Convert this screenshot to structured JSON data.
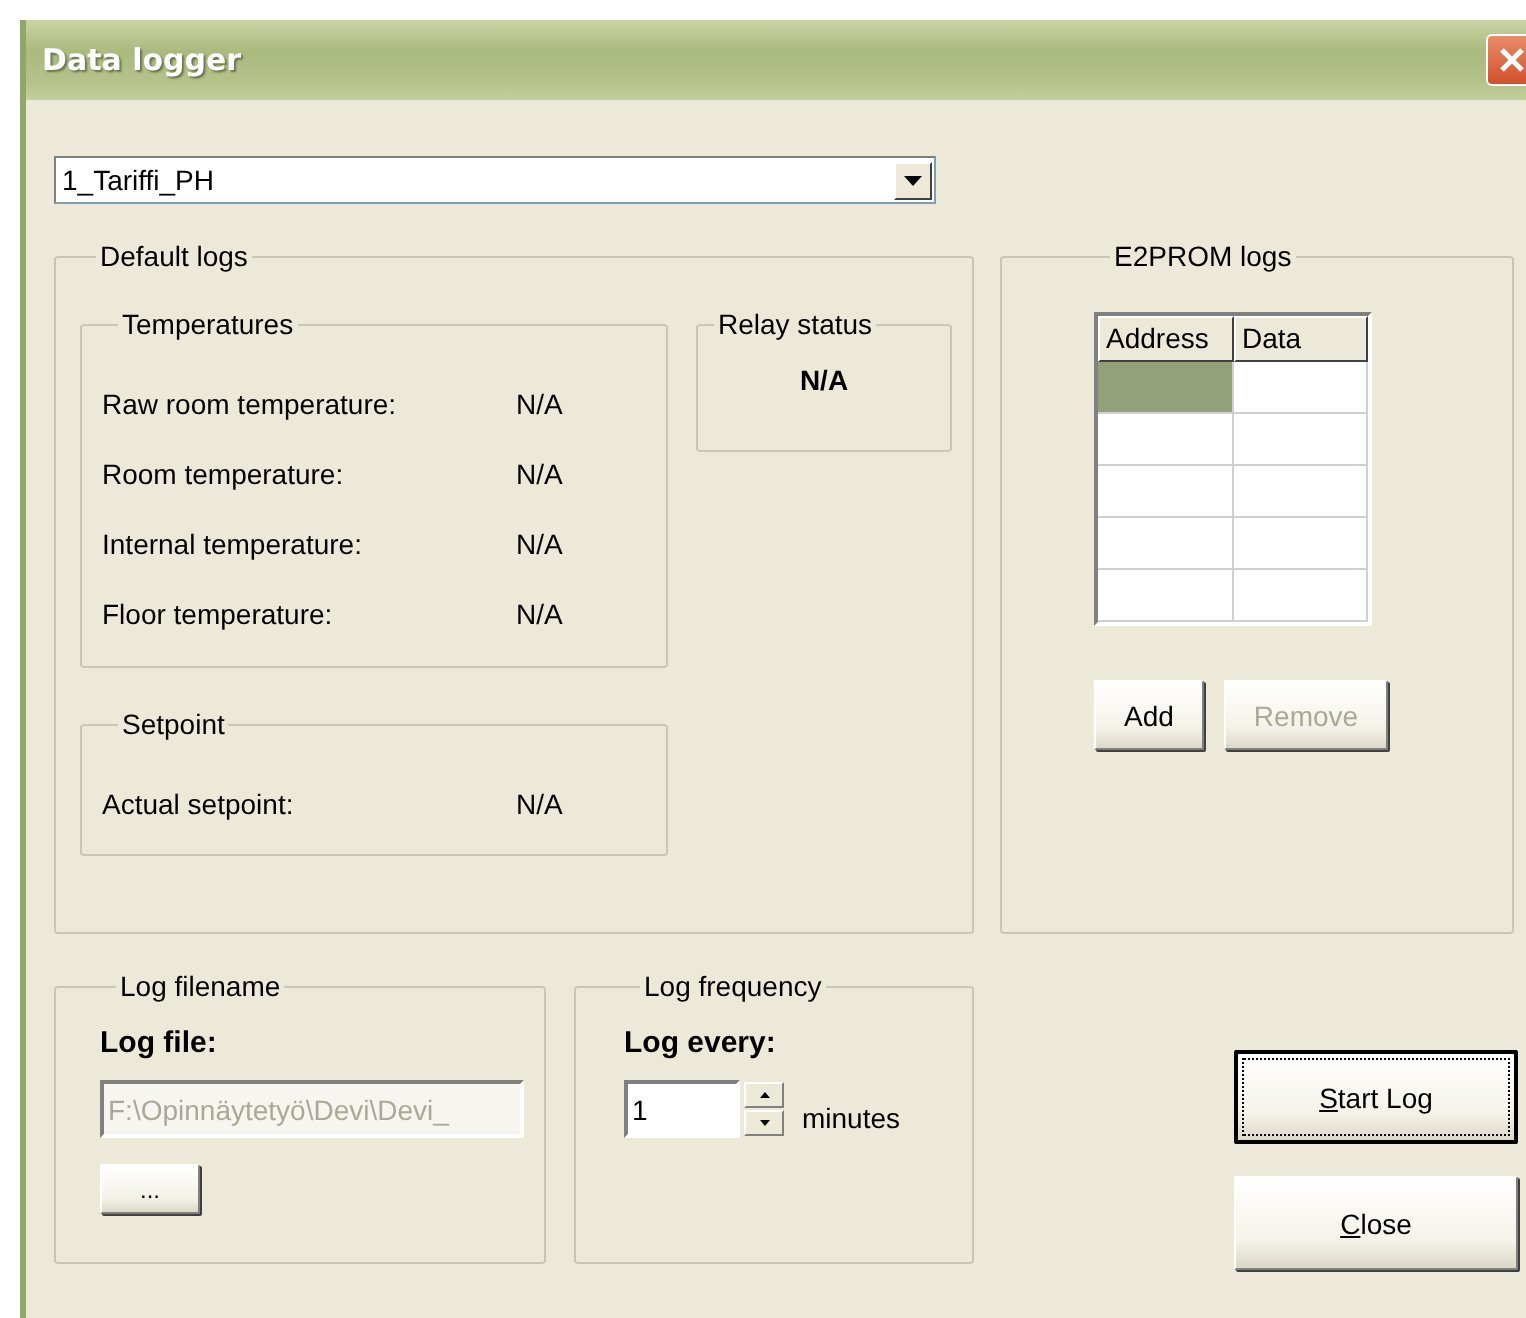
{
  "window": {
    "title": "Data logger"
  },
  "profile_select": {
    "value": "1_Tariffi_PH"
  },
  "default_logs": {
    "title": "Default logs",
    "temperatures": {
      "title": "Temperatures",
      "rows": [
        {
          "label": "Raw room temperature:",
          "value": "N/A"
        },
        {
          "label": "Room temperature:",
          "value": "N/A"
        },
        {
          "label": "Internal temperature:",
          "value": "N/A"
        },
        {
          "label": "Floor temperature:",
          "value": "N/A"
        }
      ]
    },
    "relay_status": {
      "title": "Relay status",
      "value": "N/A"
    },
    "setpoint": {
      "title": "Setpoint",
      "rows": [
        {
          "label": "Actual setpoint:",
          "value": "N/A"
        }
      ]
    }
  },
  "e2prom_logs": {
    "title": "E2PROM logs",
    "table": {
      "columns": [
        "Address",
        "Data"
      ],
      "rows": [
        {
          "cells": [
            {
              "selected": true
            },
            {
              "selected": false
            }
          ]
        },
        {
          "cells": [
            {
              "selected": false
            },
            {
              "selected": false
            }
          ]
        },
        {
          "cells": [
            {
              "selected": false
            },
            {
              "selected": false
            }
          ]
        },
        {
          "cells": [
            {
              "selected": false
            },
            {
              "selected": false
            }
          ]
        },
        {
          "cells": [
            {
              "selected": false
            },
            {
              "selected": false
            }
          ]
        }
      ]
    },
    "buttons": [
      {
        "label": "Add",
        "disabled": false
      },
      {
        "label": "Remove",
        "disabled": true
      }
    ]
  },
  "log_filename": {
    "title": "Log filename",
    "label": "Log file:",
    "value": "F:\\Opinnäytetyö\\Devi\\Devi_",
    "disabled": true,
    "browse_button": "..."
  },
  "log_frequency": {
    "title": "Log frequency",
    "label": "Log every:",
    "value": "1",
    "unit": "minutes"
  },
  "buttons": [
    {
      "label": "Start Log",
      "default": true,
      "accelerator": true
    },
    {
      "label": "Close",
      "default": false,
      "accelerator": true
    }
  ]
}
